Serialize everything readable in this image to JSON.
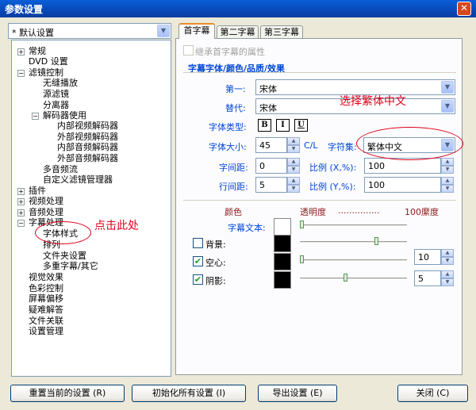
{
  "window": {
    "title": "参数设置",
    "close_label": "✕"
  },
  "profile": {
    "value": "* 默认设置"
  },
  "tree": {
    "items": [
      {
        "label": "常规",
        "expander": "+"
      },
      {
        "label": "DVD 设置"
      },
      {
        "label": "滤镜控制",
        "expander": "−"
      },
      {
        "label": "无缝播放"
      },
      {
        "label": "源滤镜"
      },
      {
        "label": "分离器"
      },
      {
        "label": "解码器使用",
        "expander": "−"
      },
      {
        "label": "内部视频解码器"
      },
      {
        "label": "外部视频解码器"
      },
      {
        "label": "内部音频解码器"
      },
      {
        "label": "外部音频解码器"
      },
      {
        "label": "多音频流"
      },
      {
        "label": "自定义滤镜管理器"
      },
      {
        "label": "插件",
        "expander": "+"
      },
      {
        "label": "视频处理",
        "expander": "+"
      },
      {
        "label": "音频处理",
        "expander": "+"
      },
      {
        "label": "字幕处理",
        "expander": "−"
      },
      {
        "label": "字体样式"
      },
      {
        "label": "排列"
      },
      {
        "label": "文件夹设置"
      },
      {
        "label": "多重字幕/其它"
      },
      {
        "label": "视觉效果"
      },
      {
        "label": "色彩控制"
      },
      {
        "label": "屏幕偏移"
      },
      {
        "label": "疑难解答"
      },
      {
        "label": "文件关联"
      },
      {
        "label": "设置管理"
      }
    ]
  },
  "tabs": [
    "首字幕",
    "第二字幕",
    "第三字幕"
  ],
  "inherit_label": "继承首字幕的属性",
  "group_title": "字幕字体/颜色/品质/效果",
  "font": {
    "first_label": "第一:",
    "first_value": "宋体",
    "alt_label": "替代:",
    "alt_value": "宋体",
    "type_label": "字体类型:",
    "bold": "B",
    "italic": "I",
    "underline": "U",
    "size_label": "字体大小:",
    "size_value": "45",
    "size_unit": "C/L",
    "charset_label": "字符集:",
    "charset_value": "繁体中文",
    "spacing_label": "字间距:",
    "spacing_value": "0",
    "line_spacing_label": "行间距:",
    "line_spacing_value": "5",
    "scale_x_label": "比例 (X,%):",
    "scale_x_value": "100",
    "scale_y_label": "比例 (Y,%):",
    "scale_y_value": "100"
  },
  "color_section": {
    "color_header": "颜色",
    "opacity_header": "透明度",
    "dots": "...............",
    "opacity_max": "100縻度",
    "text_label": "字幕文本:",
    "background_label": "背景:",
    "outline_label": "空心:",
    "shadow_label": "阴影:",
    "outline_value": "10",
    "shadow_value": "5",
    "colors": {
      "text": "#FFFFFF",
      "background": "#000000",
      "outline": "#000000",
      "shadow": "#000000"
    },
    "opacity": {
      "text": 0.0,
      "background": 0.72,
      "outline": 0.0,
      "shadow": 0.42
    }
  },
  "annotations": {
    "select_hint": "选择繁体中文",
    "click_hint": "点击此处"
  },
  "buttons": {
    "reset_current": "重置当前的设置 (R)",
    "init_all": "初始化所有设置 (I)",
    "export": "导出设置 (E)",
    "close": "关闭 (C)"
  }
}
